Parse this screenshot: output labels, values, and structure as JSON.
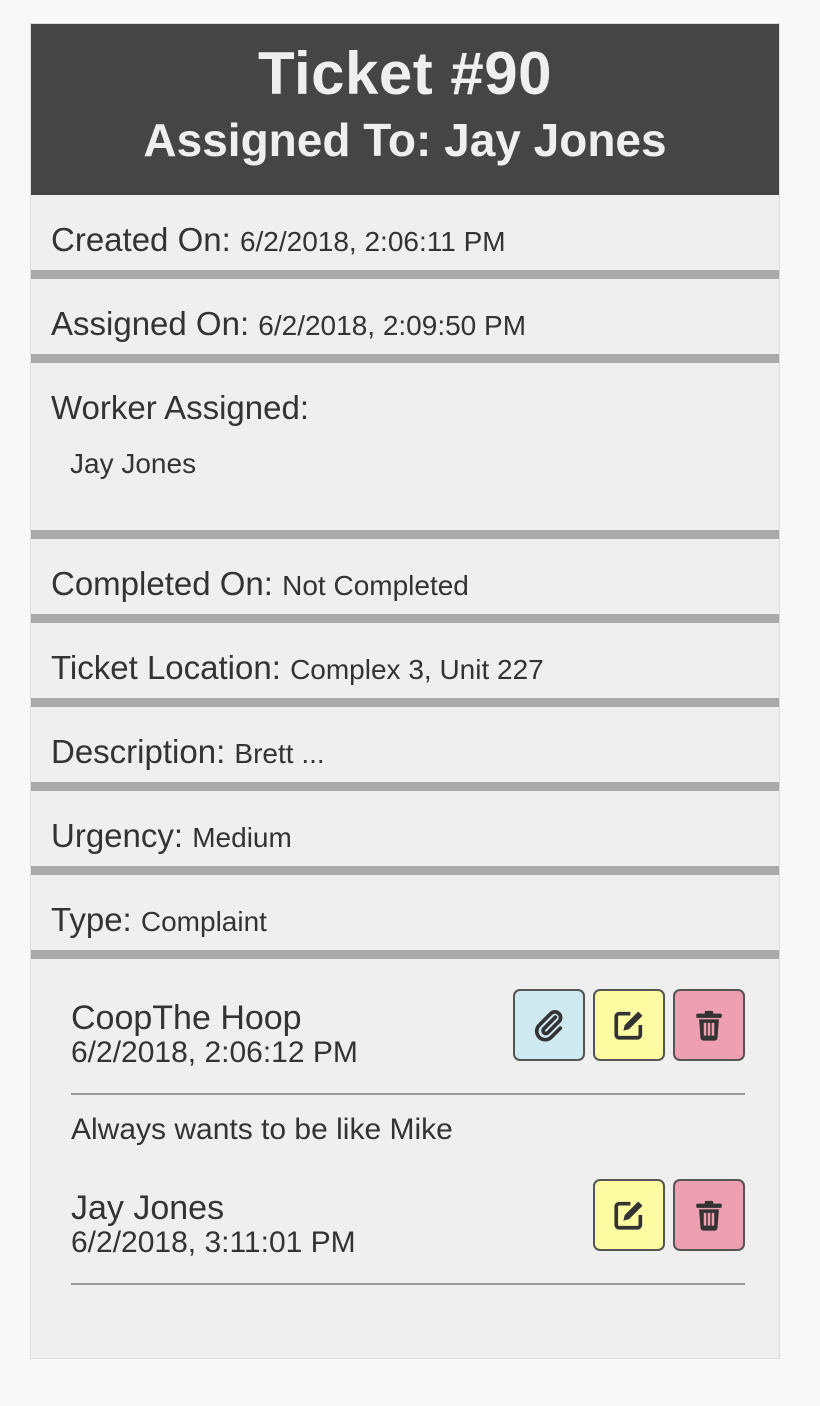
{
  "header": {
    "title": "Ticket #90",
    "subtitle": "Assigned To: Jay Jones"
  },
  "fields": {
    "created": {
      "label": "Created On: ",
      "value": "6/2/2018, 2:06:11 PM"
    },
    "assigned": {
      "label": "Assigned On: ",
      "value": "6/2/2018, 2:09:50 PM"
    },
    "worker": {
      "label": "Worker Assigned:",
      "value": "Jay Jones"
    },
    "completed": {
      "label": "Completed On: ",
      "value": "Not Completed"
    },
    "location": {
      "label": "Ticket Location: ",
      "value": "Complex 3, Unit 227"
    },
    "description": {
      "label": "Description: ",
      "value": "Brett ..."
    },
    "urgency": {
      "label": "Urgency: ",
      "value": "Medium"
    },
    "type": {
      "label": "Type: ",
      "value": "Complaint"
    }
  },
  "notes": [
    {
      "author": "CoopThe Hoop",
      "date": "6/2/2018, 2:06:12 PM",
      "text": "Always wants to be like Mike",
      "actions": [
        "paperclip-icon",
        "edit-icon",
        "trash-icon"
      ]
    },
    {
      "author": "Jay Jones",
      "date": "6/2/2018, 3:11:01 PM",
      "text": "",
      "actions": [
        "edit-icon",
        "trash-icon"
      ]
    }
  ],
  "colors": {
    "header_bg": "#454545",
    "card_bg": "#efefef",
    "divider": "#a9a9a9",
    "attach_button": "#cfe9f1",
    "edit_button": "#fdfca2",
    "delete_button": "#ef9fb2"
  }
}
